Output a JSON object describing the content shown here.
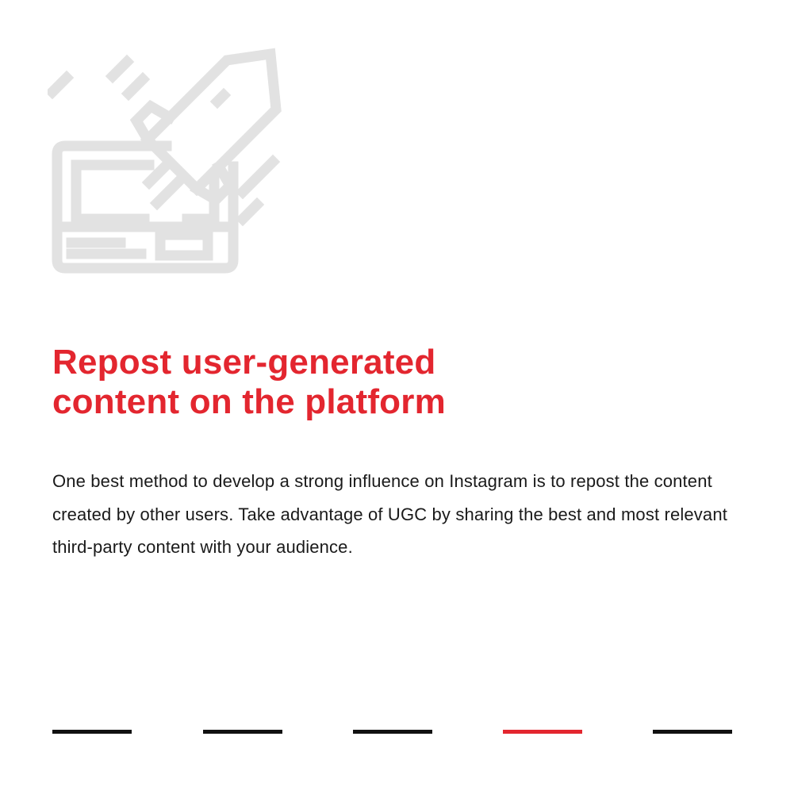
{
  "illustration": {
    "icon": "rocket-launch-from-laptop-icon",
    "stroke_color": "#e2e2e2"
  },
  "headline": {
    "line1": "Repost user-generated",
    "line2": "content on the platform",
    "color": "#e3262f"
  },
  "body": {
    "text": "One best method to develop a strong influence on Instagram is to repost the content created by other users. Take advantage of UGC by sharing the best and most relevant third-party content with your audience."
  },
  "pager": {
    "total": 5,
    "active_index": 4,
    "active_color": "#e3262f",
    "inactive_color": "#111111"
  }
}
